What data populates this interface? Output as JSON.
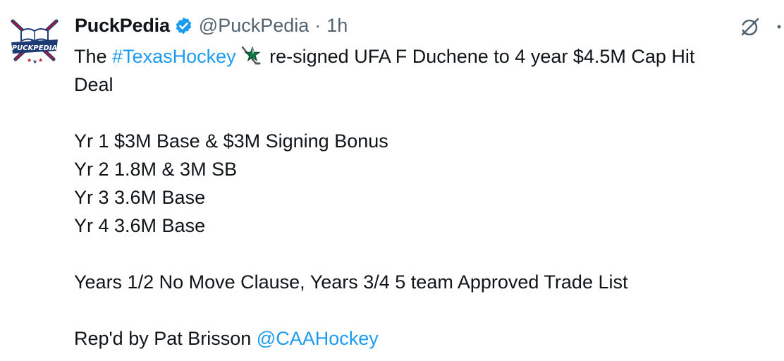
{
  "tweet": {
    "author": {
      "display_name": "PuckPedia",
      "handle": "@PuckPedia",
      "time": "1h",
      "separator": "·",
      "avatar_text": "PUCKPEDIA"
    },
    "icons": {
      "verified": "verified-badge-icon",
      "grok": "grok-icon",
      "more": "more-options-icon",
      "emoji": "dallas-stars-emoji"
    },
    "colors": {
      "link": "#1d9bf0",
      "text": "#0f1419",
      "muted": "#536471",
      "verified": "#1d9bf0"
    },
    "text": {
      "intro_prefix": "The ",
      "hashtag": "#TexasHockey",
      "intro_suffix": " re-signed UFA F Duchene to 4 year $4.5M Cap Hit",
      "intro_line2": "Deal",
      "yr1": "Yr 1 $3M Base & $3M Signing Bonus",
      "yr2": "Yr 2 1.8M & 3M SB",
      "yr3": "Yr 3 3.6M Base",
      "yr4": "Yr 4 3.6M Base",
      "clauses": "Years 1/2 No Move Clause, Years 3/4 5 team Approved Trade List",
      "rep_prefix": "Rep'd by Pat Brisson ",
      "mention": "@CAAHockey"
    }
  }
}
